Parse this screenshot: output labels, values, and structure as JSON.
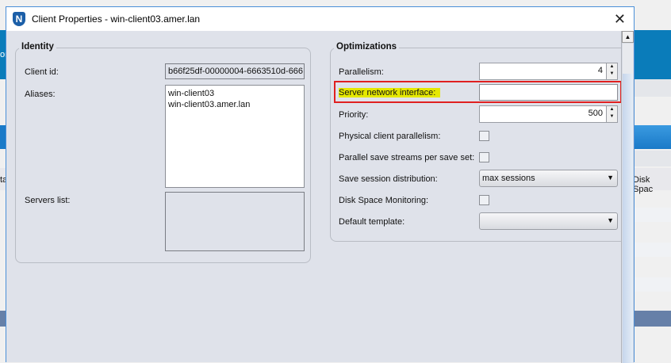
{
  "window": {
    "title": "Client Properties - win-client03.amer.lan",
    "close": "✕",
    "logo": "N"
  },
  "background": {
    "right_header": "Disk Spac",
    "left_fragment_1": "or",
    "left_fragment_2": "ta"
  },
  "identity": {
    "legend": "Identity",
    "client_id_label": "Client id:",
    "client_id": "b66f25df-00000004-6663510d-666",
    "aliases_label": "Aliases:",
    "aliases": [
      "win-client03",
      "win-client03.amer.lan"
    ],
    "servers_label": "Servers list:"
  },
  "optimizations": {
    "legend": "Optimizations",
    "parallelism_label": "Parallelism:",
    "parallelism": "4",
    "sni_label": "Server network interface:",
    "sni_value": "",
    "priority_label": "Priority:",
    "priority": "500",
    "pcp_label": "Physical client parallelism:",
    "pss_label": "Parallel save streams per save set:",
    "ssd_label": "Save session distribution:",
    "ssd_value": "max sessions",
    "dsm_label": "Disk Space Monitoring:",
    "template_label": "Default template:",
    "template_value": ""
  },
  "colors": {
    "highlight": "#e5e800",
    "callout": "#e02020",
    "accent": "#0a7cba"
  }
}
